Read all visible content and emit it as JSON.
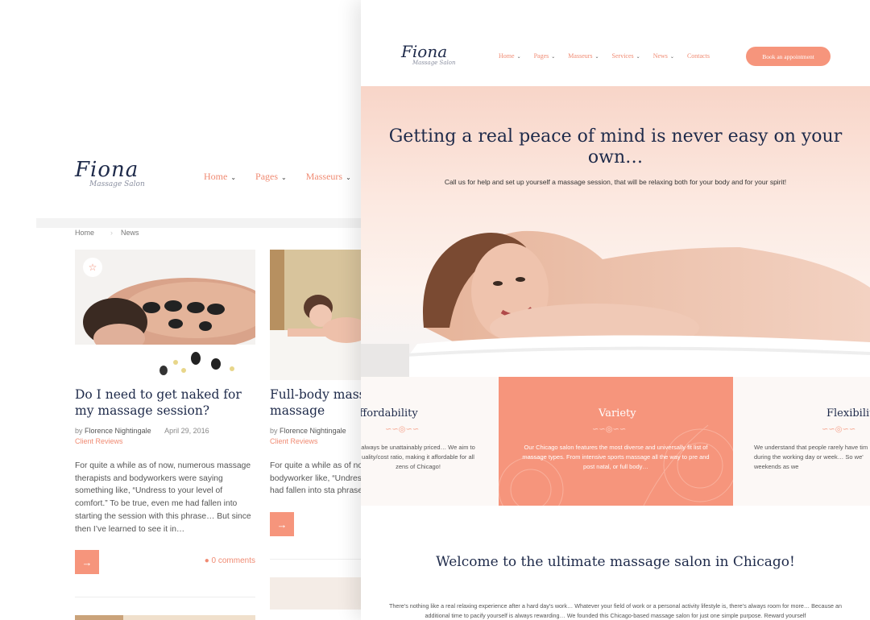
{
  "back_page": {
    "logo": {
      "name": "Fiona",
      "tagline": "Massage Salon"
    },
    "nav": [
      {
        "label": "Home"
      },
      {
        "label": "Pages"
      },
      {
        "label": "Masseurs"
      }
    ],
    "breadcrumb": {
      "home": "Home",
      "current": "News"
    },
    "posts": [
      {
        "title": "Do I need to get naked for my massage session?",
        "author_prefix": "by",
        "author": "Florence Nightingale",
        "date": "April 29, 2016",
        "category": "Client Reviews",
        "excerpt": "For quite a while as of now, numerous massage therapists and bodyworkers were saying something like, “Undress to your level of comfort.” To be true, even me had fallen into starting the session with this phrase… But since then I’ve learned to see it in…",
        "comments": "0 comments"
      },
      {
        "title": "Full-body mass Neck massage",
        "author_prefix": "by",
        "author": "Florence Nightingale",
        "category": "Client Reviews",
        "excerpt": "For quite a while as of now therapists and bodyworker like, “Undress to your level even me had fallen into sta phrase… But since then I’ve"
      }
    ]
  },
  "front_page": {
    "logo": {
      "name": "Fiona",
      "tagline": "Massage Salon"
    },
    "nav": [
      {
        "label": "Home"
      },
      {
        "label": "Pages"
      },
      {
        "label": "Masseurs"
      },
      {
        "label": "Services"
      },
      {
        "label": "News"
      },
      {
        "label": "Contacts"
      }
    ],
    "book_button": "Book an appointment",
    "hero": {
      "title": "Getting a real peace of mind is never easy on your own…",
      "subtitle": "Call us for help and set up yourself a massage session, that will be relaxing both for your body and for your spirit!"
    },
    "features": [
      {
        "title": "ffordability",
        "text": "always be unattainably priced… We aim to uality/cost ratio, making it affordable for all zens of Chicago!"
      },
      {
        "title": "Variety",
        "text": "Our Chicago salon features the most diverse and universally fit list of massage types. From intensive sports massage all the way to pre and post natal, or full body…"
      },
      {
        "title": "Flexibilit",
        "text": "We understand that people rarely have tim during the working day or week… So we' weekends as we"
      }
    ],
    "welcome": {
      "title": "Welcome to the ultimate massage salon in Chicago!",
      "text": "There’s nothing like a real relaxing experience after a hard day’s work… Whatever your field of work or a personal activity lifestyle is, there’s always room for more… Because an additional time to pacify yourself is always rewarding… We founded this Chicago-based massage salon for just one simple purpose. Reward yourself"
    }
  },
  "colors": {
    "accent": "#f6957c",
    "navy": "#1e2a4a",
    "link": "#f08b73"
  }
}
